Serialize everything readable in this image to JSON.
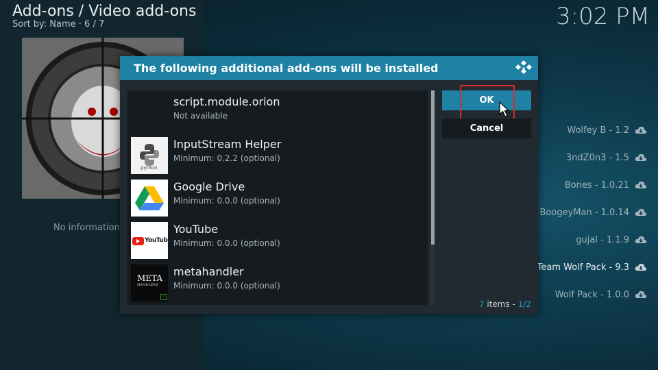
{
  "header": {
    "title": "Add-ons / Video add-ons",
    "subtitle": "Sort by: Name  ·  6 / 7",
    "clock": "3:02 PM"
  },
  "left_panel": {
    "no_info": "No information a"
  },
  "side_list": [
    {
      "label": "Wolfey B - 1.2"
    },
    {
      "label": "3ndZ0n3 - 1.5"
    },
    {
      "label": "Bones - 1.0.21"
    },
    {
      "label": "BoogeyMan - 1.0.14"
    },
    {
      "label": "gujal - 1.1.9"
    },
    {
      "label": "Team Wolf Pack - 9.3"
    },
    {
      "label": "Wolf Pack - 1.0.0"
    }
  ],
  "dialog": {
    "title": "The following additional add-ons will be installed",
    "items": [
      {
        "name": "script.module.orion",
        "detail": "Not available",
        "icon": "blank-icon"
      },
      {
        "name": "InputStream Helper",
        "detail": "Minimum: 0.2.2 (optional)",
        "icon": "python-icon",
        "icon_text": "python"
      },
      {
        "name": "Google Drive",
        "detail": "Minimum: 0.0.0 (optional)",
        "icon": "google-drive-icon"
      },
      {
        "name": "YouTube",
        "detail": "Minimum: 0.0.0 (optional)",
        "icon": "youtube-icon",
        "icon_text": "YouTube"
      },
      {
        "name": "metahandler",
        "detail": "Minimum: 0.0.0 (optional)",
        "icon": "metahandler-icon",
        "icon_text": "META",
        "icon_subtext": "HANDLERS"
      }
    ],
    "scroll_fraction": 0.72,
    "ok_label": "OK",
    "cancel_label": "Cancel",
    "count_prefix": "7",
    "count_mid": " items - ",
    "count_page": "1/2"
  },
  "colors": {
    "accent": "#1f82a4",
    "highlight_outline": "#e02a2a"
  }
}
